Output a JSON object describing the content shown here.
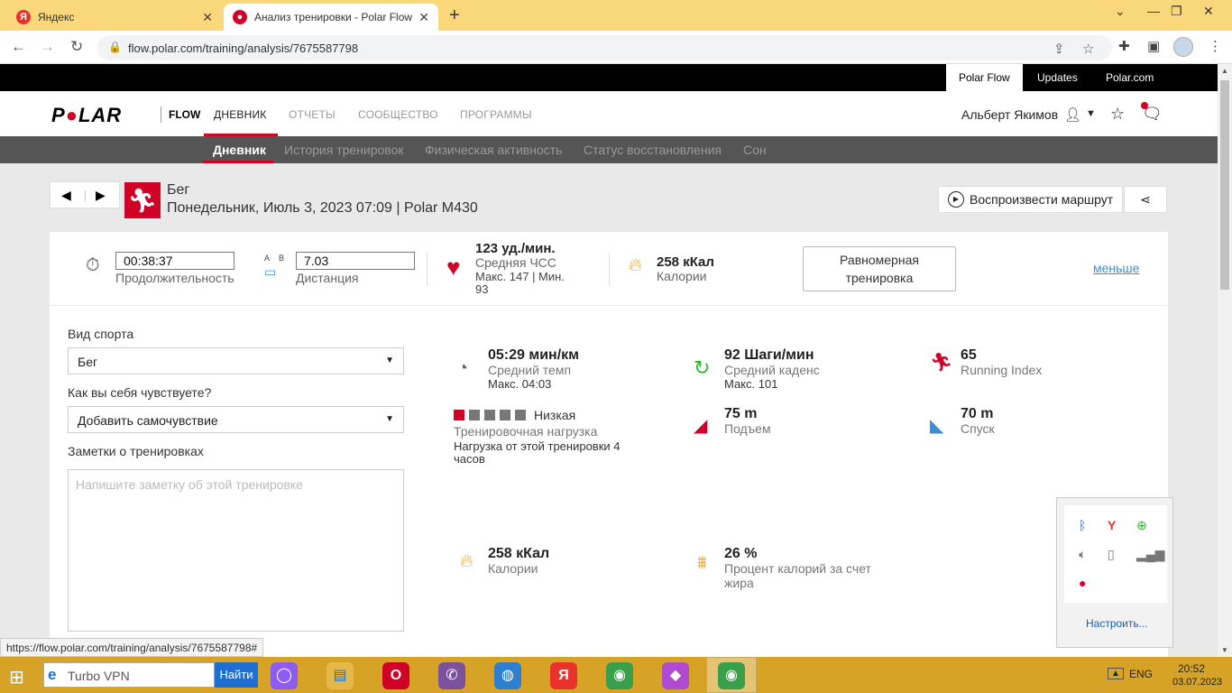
{
  "browser": {
    "tabs": [
      {
        "title": "Яндекс",
        "active": false,
        "favicon": "yandex-icon"
      },
      {
        "title": "Анализ тренировки - Polar Flow",
        "active": true,
        "favicon": "polar-icon"
      }
    ],
    "url": "flow.polar.com/training/analysis/7675587798",
    "status_url": "https://flow.polar.com/training/analysis/7675587798#"
  },
  "topbar": {
    "links": [
      "Polar Flow",
      "Updates",
      "Polar.com"
    ],
    "active": "Polar Flow"
  },
  "header": {
    "logo": "POLAR",
    "flow": "FLOW",
    "nav": [
      "ДНЕВНИК",
      "ОТЧЕТЫ",
      "СООБЩЕСТВО",
      "ПРОГРАММЫ"
    ],
    "active_nav": "ДНЕВНИК",
    "username": "Альберт Якимов"
  },
  "subnav": {
    "items": [
      "Дневник",
      "История тренировок",
      "Физическая активность",
      "Статус восстановления",
      "Сон"
    ],
    "active": "Дневник"
  },
  "session": {
    "sport": "Бег",
    "subtitle": "Понедельник, Июль 3, 2023 07:09 | Polar M430",
    "play_route": "Воспроизвести маршрут"
  },
  "summary": {
    "duration_value": "00:38:37",
    "duration_label": "Продолжительность",
    "distance_value": "7.03",
    "distance_label": "Дистанция",
    "distance_ab": "A B",
    "hr_value": "123 уд./мин.",
    "hr_label": "Средняя ЧСС",
    "hr_range_1": "Макс. 147  |  Мин.",
    "hr_range_2": "93",
    "kcal_value": "258 кКал",
    "kcal_label": "Калории",
    "steady_line1": "Равномерная",
    "steady_line2": "тренировка",
    "less_link": "меньше"
  },
  "form": {
    "sport_label": "Вид спорта",
    "sport_value": "Бег",
    "feeling_label": "Как вы себя чувствуете?",
    "feeling_value": "Добавить самочувствие",
    "notes_label": "Заметки о тренировках",
    "notes_placeholder": "Напишите заметку об этой тренировке"
  },
  "metrics": {
    "pace_value": "05:29 мин/км",
    "pace_label": "Средний темп",
    "pace_sub": "Макс. 04:03",
    "cadence_value": "92 Шаги/мин",
    "cadence_label": "Средний каденс",
    "cadence_sub": "Макс. 101",
    "ri_value": "65",
    "ri_label": "Running Index",
    "load_level": "Низкая",
    "load_filled": 1,
    "load_total": 5,
    "load_label": "Тренировочная нагрузка",
    "load_sub_1": "Нагрузка от этой тренировки 4",
    "load_sub_2": "часов",
    "ascent_value": "75 m",
    "ascent_label": "Подъем",
    "descent_value": "70 m",
    "descent_label": "Спуск",
    "kcal_value": "258 кКал",
    "kcal_label": "Калории",
    "fat_value": "26 %",
    "fat_label_1": "Процент калорий за счет",
    "fat_label_2": "жира"
  },
  "tray_popup": {
    "customize": "Настроить..."
  },
  "taskbar": {
    "search_text": "Turbo VPN",
    "search_button": "Найти",
    "lang": "ENG",
    "time": "20:52",
    "date": "03.07.2023"
  },
  "colors": {
    "polar_red": "#d10027",
    "taskbar": "#d6a327",
    "tabstrip": "#f9d77a",
    "link_blue": "#3a8ed6"
  }
}
